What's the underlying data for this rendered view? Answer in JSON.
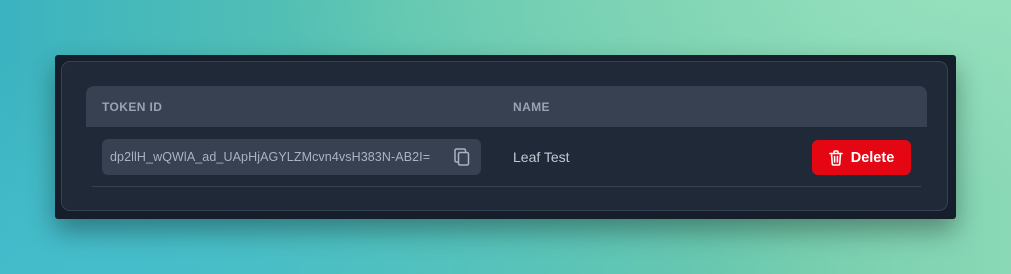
{
  "table": {
    "headers": {
      "token_id": "TOKEN ID",
      "name": "NAME"
    },
    "rows": [
      {
        "token_id": "dp2llH_wQWlA_ad_UApHjAGYLZMcvn4vsH383N-AB2I=",
        "name": "Leaf Test",
        "delete_label": "Delete",
        "copy_icon": "copy-icon",
        "delete_icon": "trash-icon"
      }
    ]
  },
  "colors": {
    "danger": "#e40613",
    "card_background": "#1f2937",
    "header_background": "#374151"
  }
}
